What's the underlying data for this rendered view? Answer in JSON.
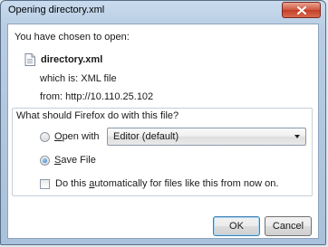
{
  "window": {
    "title": "Opening directory.xml"
  },
  "dialog": {
    "chosen_text": "You have chosen to open:",
    "file_name": "directory.xml",
    "which_label": "which is:",
    "which_value": "XML file",
    "from_label": "from:",
    "from_value": "http://10.110.25.102",
    "question": "What should Firefox do with this file?",
    "open_with": {
      "mnemonic": "O",
      "rest": "pen with",
      "selected": false,
      "select_value": "Editor (default)"
    },
    "save_file": {
      "mnemonic": "S",
      "rest": "ave File",
      "selected": true
    },
    "auto": {
      "before": "Do this ",
      "mnemonic": "a",
      "after": "utomatically for files like this from now on.",
      "checked": false
    },
    "buttons": {
      "ok": "OK",
      "cancel": "Cancel"
    }
  }
}
